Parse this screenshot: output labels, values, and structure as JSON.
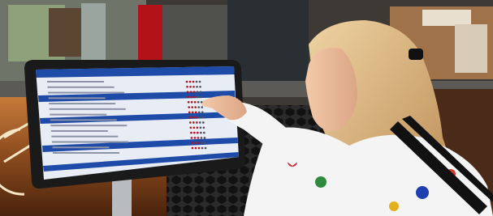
{
  "scene": {
    "subject": "woman-using-feedback-kiosk",
    "colors": {
      "counter": "#7a3a14",
      "wall_tiles": "#1f1f1f",
      "screen_bar": "#1e4aa8",
      "screen_bg": "#e8ecf4",
      "hair": "#d9b27c",
      "jacket": "#ffffff",
      "stripes": "#111111"
    }
  },
  "kiosk": {
    "screen": {
      "rating_rows": 14,
      "section_bars": 4,
      "stars_per_row": 5
    }
  }
}
